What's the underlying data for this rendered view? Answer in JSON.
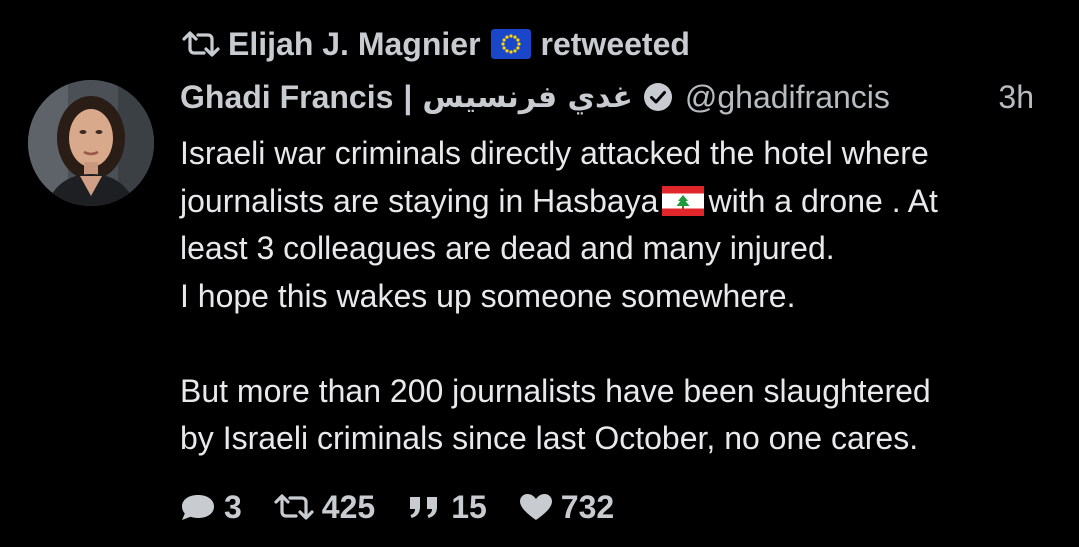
{
  "retweet_header": {
    "retweeter_name": "Elijah J. Magnier",
    "retweeted_label": "retweeted",
    "icon": "retweet-icon",
    "flag": "eu-flag"
  },
  "author": {
    "name": "Ghadi Francis",
    "separator": "|",
    "arabic_name": "غدي فرنسيس",
    "verified_icon": "verified-badge-icon",
    "handle": "@ghadifrancis",
    "timestamp": "3h",
    "avatar": "avatar"
  },
  "body": {
    "line1": "Israeli war criminals directly attacked the hotel where",
    "line2_before_flag": "journalists are staying in Hasbaya",
    "line2_flag": "lebanon-flag",
    "line2_after_flag": "with a drone . At",
    "line3": "least 3 colleagues are dead and many injured.",
    "line4": "I hope this wakes up someone somewhere.",
    "line5": "But more than 200 journalists have been slaughtered",
    "line6": "by Israeli criminals since last October, no one cares."
  },
  "actions": {
    "reply": {
      "icon": "reply-icon",
      "count": "3"
    },
    "retweet": {
      "icon": "retweet-icon",
      "count": "425"
    },
    "quote": {
      "icon": "quote-icon",
      "count": "15"
    },
    "like": {
      "icon": "heart-icon",
      "count": "732"
    }
  },
  "colors": {
    "background": "#000000",
    "text_primary": "#e7e9ea",
    "text_secondary": "#c8ccd0",
    "eu_blue": "#1a47c9",
    "eu_star": "#ffd400",
    "lebanon_red": "#e0262a",
    "lebanon_cedar": "#1f9a3c"
  }
}
